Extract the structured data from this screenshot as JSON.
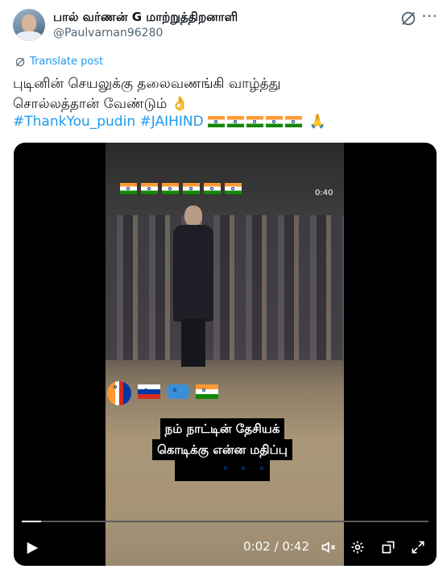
{
  "post": {
    "author_name": "பால் வர்ணன் G மாற்றுத்திறனாளி",
    "handle": "@Paulvarnan96280",
    "translate_label": "Translate post",
    "text_line1": "புடினின் செயலுக்கு தலைவணங்கி வாழ்த்து",
    "text_line2": "சொல்லத்தான் வேண்டும் 👌",
    "hashtag1": "#ThankYou_pudin",
    "hashtag2": "#JAIHIND",
    "more_label": "⋯"
  },
  "video": {
    "overlay_time": "0:40",
    "caption_line1": "நம் நாட்டின் தேசியக்",
    "caption_line2": "கொடிக்கு என்ன மதிப்பு",
    "progress_fraction": 0.048,
    "time_current": "0:02",
    "time_total": "0:42",
    "time_separator": "/"
  },
  "icons": {
    "grok": "grok-icon",
    "more": "more-icon",
    "play": "play-icon",
    "mute": "mute-icon",
    "settings": "settings-icon",
    "popout": "popout-icon",
    "fullscreen": "fullscreen-icon"
  },
  "colors": {
    "link": "#1d9bf0",
    "text": "#0f1419",
    "secondary": "#536471",
    "video_bg": "#000000"
  }
}
